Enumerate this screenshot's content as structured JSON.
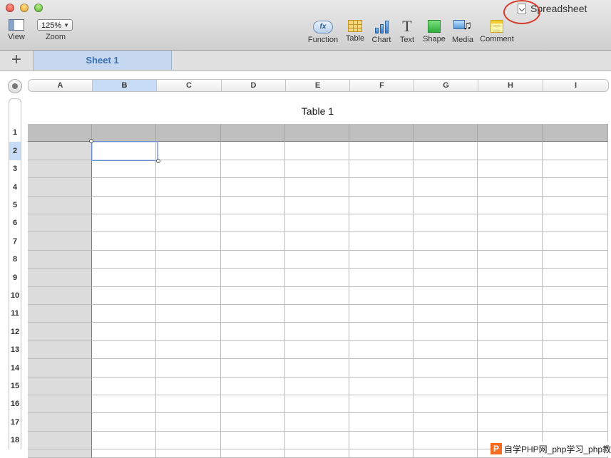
{
  "window": {
    "title": "Spreadsheet"
  },
  "toolbar": {
    "view_label": "View",
    "zoom_value": "125%",
    "zoom_label": "Zoom",
    "function_label": "Function",
    "function_icon_text": "fx",
    "table_label": "Table",
    "chart_label": "Chart",
    "text_label": "Text",
    "text_icon_glyph": "T",
    "shape_label": "Shape",
    "media_label": "Media",
    "comment_label": "Comment"
  },
  "tabs": {
    "add_glyph": "+",
    "sheets": [
      "Sheet 1"
    ]
  },
  "grid": {
    "columns": [
      "A",
      "B",
      "C",
      "D",
      "E",
      "F",
      "G",
      "H",
      "I"
    ],
    "selected_column": "B",
    "rows": [
      "1",
      "2",
      "3",
      "4",
      "5",
      "6",
      "7",
      "8",
      "9",
      "10",
      "11",
      "12",
      "13",
      "14",
      "15",
      "16",
      "17",
      "18"
    ],
    "selected_row": "2",
    "table_title": "Table 1"
  },
  "watermark": {
    "logo": "P",
    "text": "自学PHP网_php学习_php教"
  },
  "colors": {
    "annotation_circle": "#d33b2a",
    "sheet_tab": "#c5d8ef",
    "selection": "#6a8fc4"
  }
}
